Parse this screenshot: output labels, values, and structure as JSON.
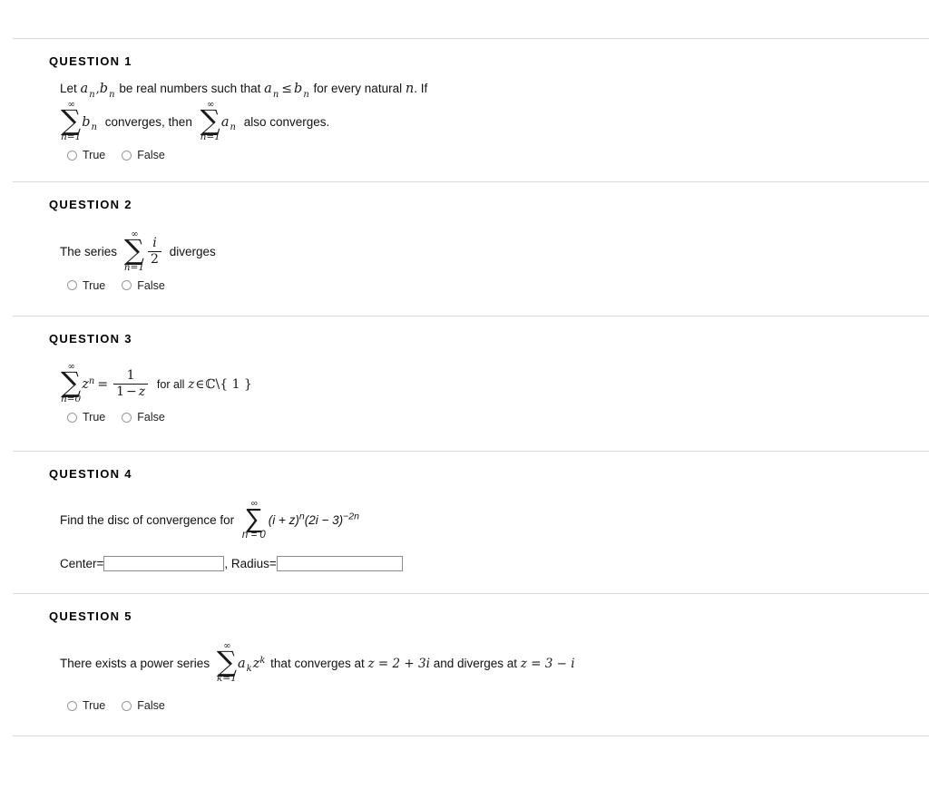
{
  "questions": [
    {
      "id": "q1",
      "heading": "QUESTION 1",
      "statement_part1": "Let",
      "var_a": "a",
      "sub_n": "n",
      "comma": ",",
      "var_b": "b",
      "statement_part2": "be real numbers such that",
      "relation": "≤",
      "statement_part3": "for every natural",
      "var_n": "n",
      "statement_part4": ". If",
      "sum_top": "∞",
      "sum_bottom": "n=1",
      "sum_body_b": "b",
      "statement_part5": "converges, then",
      "sum_body_a": "a",
      "statement_part6": "also converges.",
      "options": [
        "True",
        "False"
      ]
    },
    {
      "id": "q2",
      "heading": "QUESTION 2",
      "statement_part1": "The series",
      "sum_top": "∞",
      "sum_bottom": "n=1",
      "frac_num": "i",
      "frac_den": "2",
      "statement_part2": "diverges",
      "options": [
        "True",
        "False"
      ]
    },
    {
      "id": "q3",
      "heading": "QUESTION 3",
      "sum_top": "∞",
      "sum_bottom": "n=0",
      "term": "z",
      "term_exp": "n",
      "equals": "=",
      "frac_num": "1",
      "frac_den_a": "1",
      "frac_den_minus": "−",
      "frac_den_b": "z",
      "statement_part1": "for all",
      "membership_var": "z",
      "membership_op": "∈",
      "membership_set": "ℂ",
      "membership_excl": "\\{ 1 }",
      "options": [
        "True",
        "False"
      ]
    },
    {
      "id": "q4",
      "heading": "QUESTION 4",
      "statement_part1": "Find the disc of convergence for",
      "sum_top": "∞",
      "sum_bottom": "n = 0",
      "expr": "(i + z)",
      "expr_exp": "n",
      "expr2": "(2i − 3)",
      "expr2_exp": "−2n",
      "center_label": "Center=",
      "center_value": "",
      "center_placeholder": "",
      "separator_label": ", Radius=",
      "radius_value": "",
      "radius_placeholder": ""
    },
    {
      "id": "q5",
      "heading": "QUESTION 5",
      "statement_part1": "There exists a power series",
      "sum_top": "∞",
      "sum_bottom": "k=1",
      "coef": "a",
      "coef_sub": "k",
      "term": "z",
      "term_exp": "k",
      "statement_part2": "that converges at",
      "point1": "z = 2 + 3i",
      "statement_part3": "and diverges at",
      "point2": "z = 3 − i",
      "options": [
        "True",
        "False"
      ]
    }
  ],
  "colors": {
    "separator": "#d9d9d9",
    "input_border": "#8c8c8c",
    "radio_border": "#9a9a9a",
    "text": "#000000"
  }
}
